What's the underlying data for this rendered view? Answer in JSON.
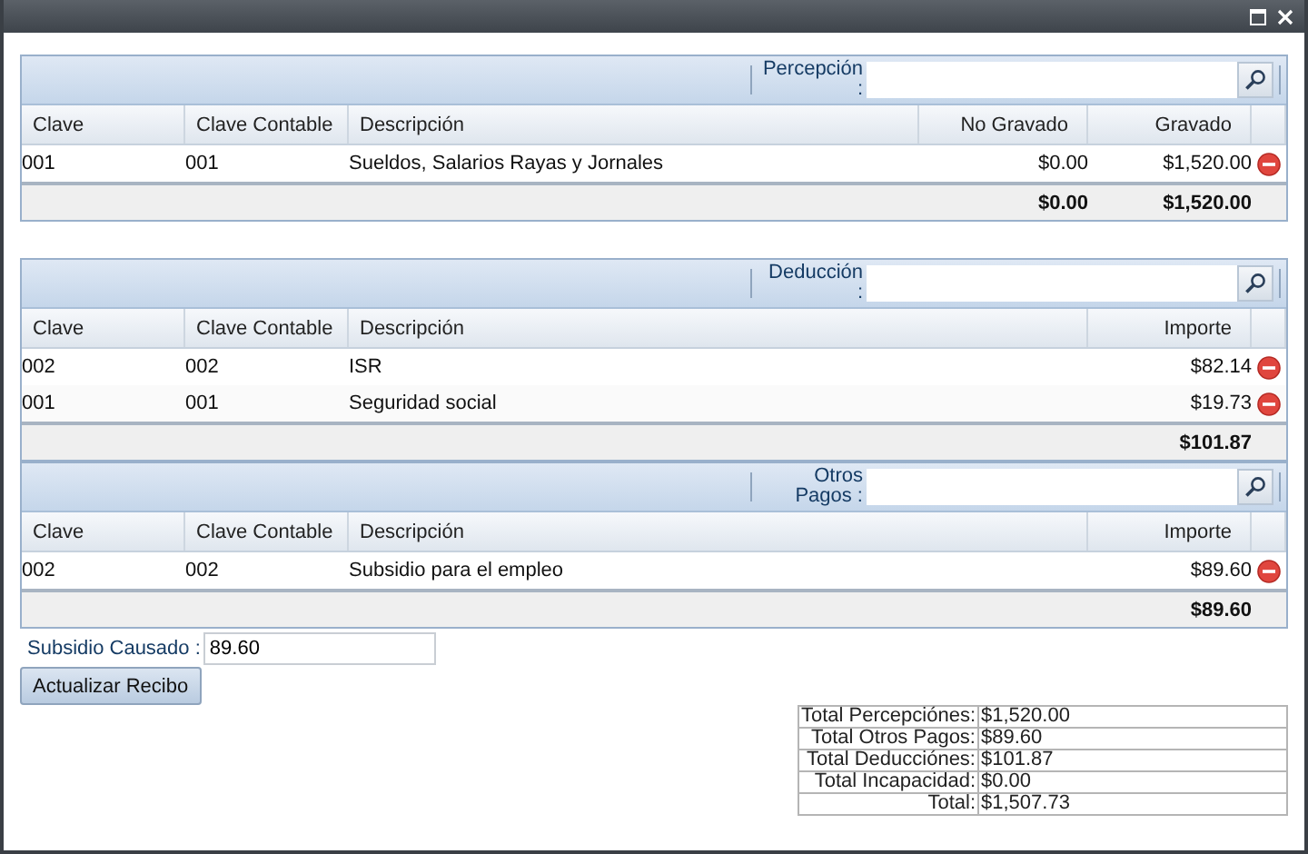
{
  "sections": [
    {
      "search_label": "Percepción :",
      "columns": [
        "Clave",
        "Clave Contable",
        "Descripción",
        "No Gravado",
        "Gravado"
      ],
      "rows": [
        {
          "cells": [
            "001",
            "001",
            "Sueldos, Salarios Rayas y Jornales",
            "$0.00",
            "$1,520.00"
          ]
        }
      ],
      "totals": [
        "$0.00",
        "$1,520.00"
      ]
    },
    {
      "search_label": "Deducción :",
      "columns": [
        "Clave",
        "Clave Contable",
        "Descripción",
        "Importe"
      ],
      "rows": [
        {
          "cells": [
            "002",
            "002",
            "ISR",
            "$82.14"
          ]
        },
        {
          "cells": [
            "001",
            "001",
            "Seguridad social",
            "$19.73"
          ]
        }
      ],
      "totals": [
        "$101.87"
      ]
    },
    {
      "search_label": "Otros Pagos :",
      "columns": [
        "Clave",
        "Clave Contable",
        "Descripción",
        "Importe"
      ],
      "rows": [
        {
          "cells": [
            "002",
            "002",
            "Subsidio para el empleo",
            "$89.60"
          ]
        }
      ],
      "totals": [
        "$89.60"
      ]
    }
  ],
  "subsidio": {
    "label": "Subsidio Causado :",
    "value": "89.60"
  },
  "update_button": "Actualizar Recibo",
  "summary": [
    {
      "label": "Total Percepciónes:",
      "value": "$1,520.00"
    },
    {
      "label": "Total Otros Pagos:",
      "value": "$89.60"
    },
    {
      "label": "Total Deducciónes:",
      "value": "$101.87"
    },
    {
      "label": "Total Incapacidad:",
      "value": "$0.00"
    },
    {
      "label": "Total:",
      "value": "$1,507.73"
    }
  ]
}
